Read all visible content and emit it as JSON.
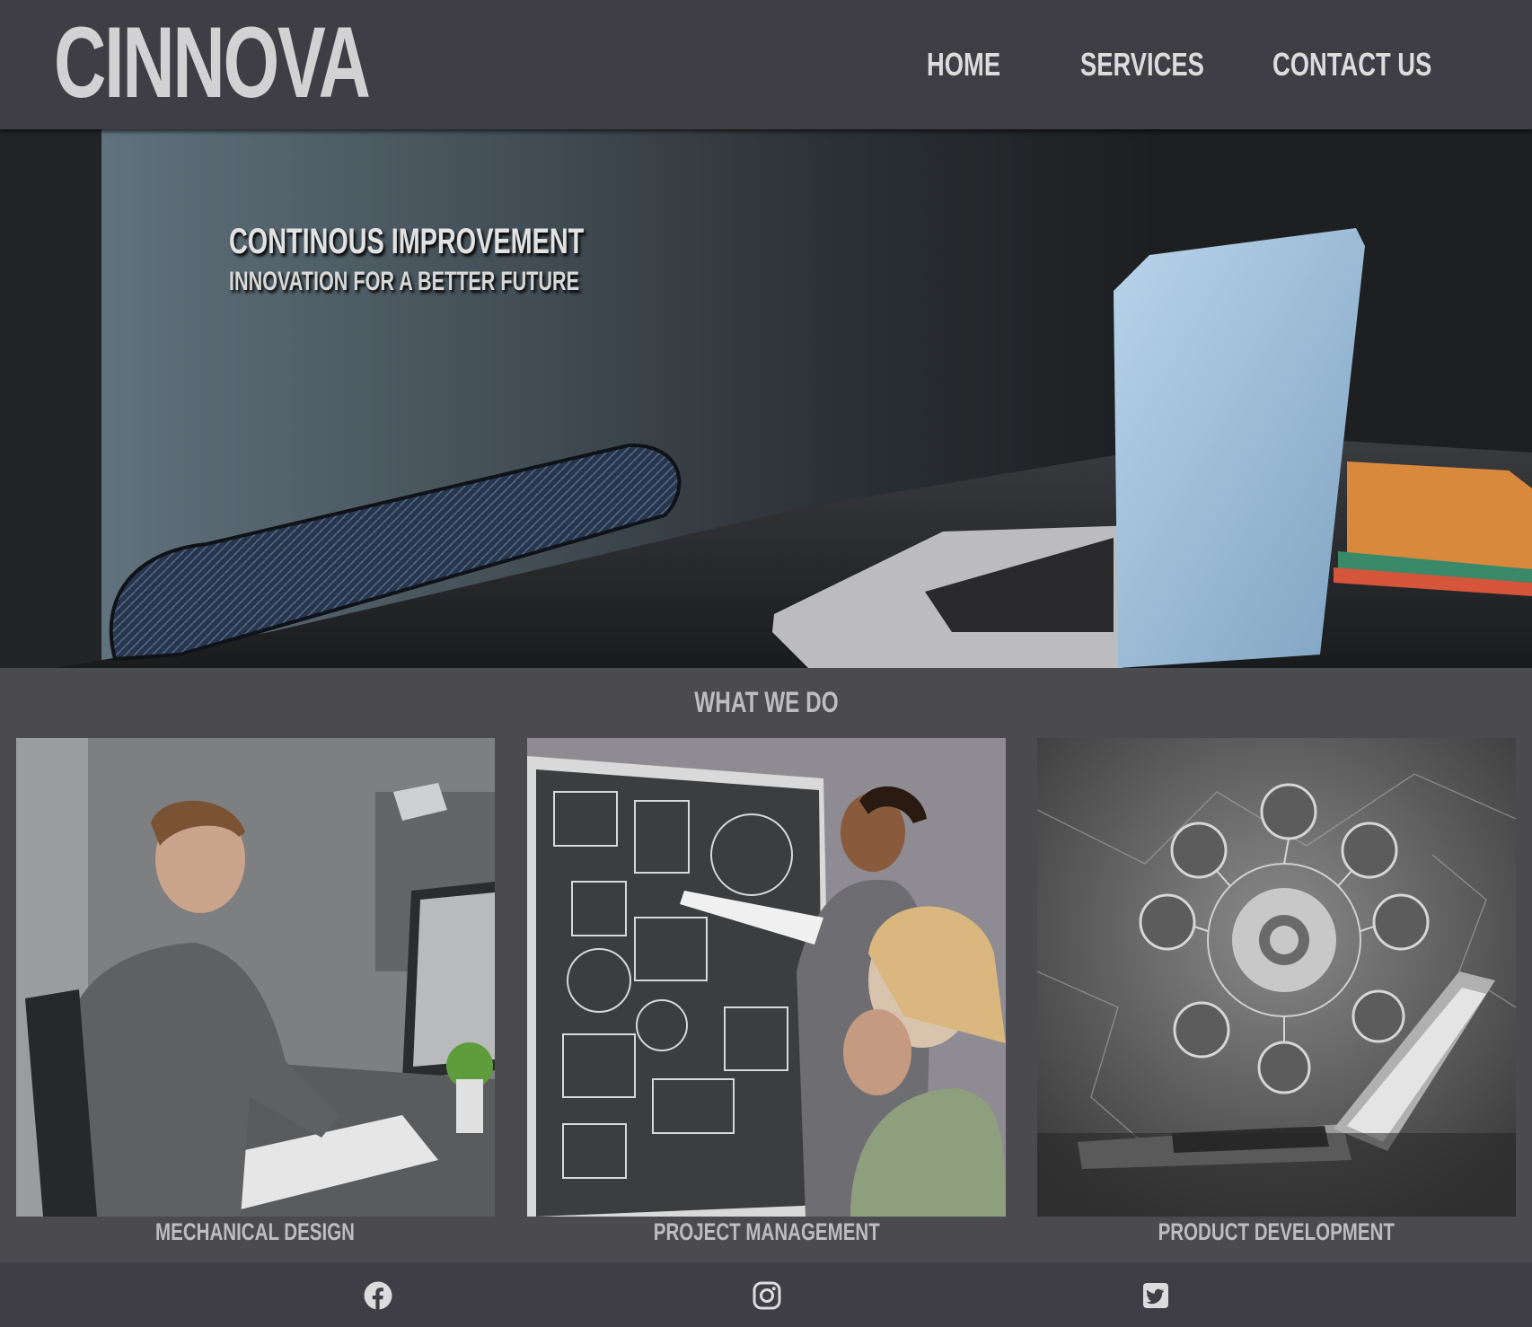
{
  "header": {
    "logo": "CINNOVA",
    "nav": [
      {
        "label": "HOME"
      },
      {
        "label": "SERVICES"
      },
      {
        "label": "CONTACT US"
      }
    ]
  },
  "hero": {
    "title": "CONTINOUS IMPROVEMENT",
    "subtitle": "INNOVATION FOR A BETTER FUTURE"
  },
  "services": {
    "title": "WHAT WE DO",
    "items": [
      {
        "label": "MECHANICAL DESIGN",
        "image": "engineer-at-drafting-desk-image"
      },
      {
        "label": "PROJECT MANAGEMENT",
        "image": "team-at-chalkboard-image"
      },
      {
        "label": "PRODUCT DEVELOPMENT",
        "image": "gear-network-laptop-image"
      }
    ]
  },
  "footer": {
    "social": [
      {
        "icon": "facebook-icon"
      },
      {
        "icon": "instagram-icon"
      },
      {
        "icon": "twitter-icon"
      }
    ]
  },
  "colors": {
    "header_bg": "#3e3e44",
    "page_bg": "#4a4a4f",
    "logo_text": "#d2d2d4",
    "heading_text": "#bdbdc0"
  }
}
